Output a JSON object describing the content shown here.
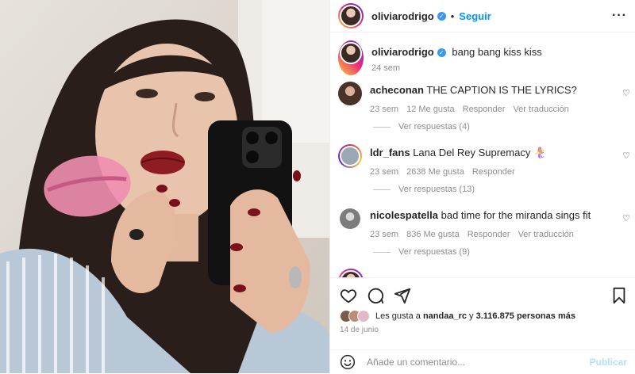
{
  "header": {
    "username": "oliviarodrigo",
    "separator": "•",
    "follow_label": "Seguir",
    "more_label": "•••",
    "avatar_icon": "profile-photo"
  },
  "caption": {
    "username": "oliviarodrigo",
    "text": "bang bang kiss kiss",
    "time": "24 sem"
  },
  "comments": [
    {
      "username": "acheconan",
      "text": "THE CAPTION IS THE LYRICS?",
      "time": "23 sem",
      "likes": "12 Me gusta",
      "reply": "Responder",
      "translate": "Ver traducción",
      "replies": "Ver respuestas (4)"
    },
    {
      "username": "ldr_fans",
      "text": "Lana Del Rey Supremacy 🧜‍♀️",
      "time": "23 sem",
      "likes": "2638 Me gusta",
      "reply": "Responder",
      "translate": "",
      "replies": "Ver respuestas (13)"
    },
    {
      "username": "nicolespatella",
      "text": "bad time for the miranda sings fit",
      "time": "23 sem",
      "likes": "836 Me gusta",
      "reply": "Responder",
      "translate": "Ver traducción",
      "replies": "Ver respuestas (9)"
    }
  ],
  "likes": {
    "prefix": "Les gusta a",
    "user": "nandaa_rc",
    "middle": "y",
    "count": "3.116.875 personas más"
  },
  "date": "14 de junio",
  "comment_box": {
    "placeholder": "Añade un comentario...",
    "publish_label": "Publicar"
  },
  "colors": {
    "accent": "#0095f6",
    "muted": "#8e8e8e",
    "publish_disabled": "#b2dffc"
  }
}
